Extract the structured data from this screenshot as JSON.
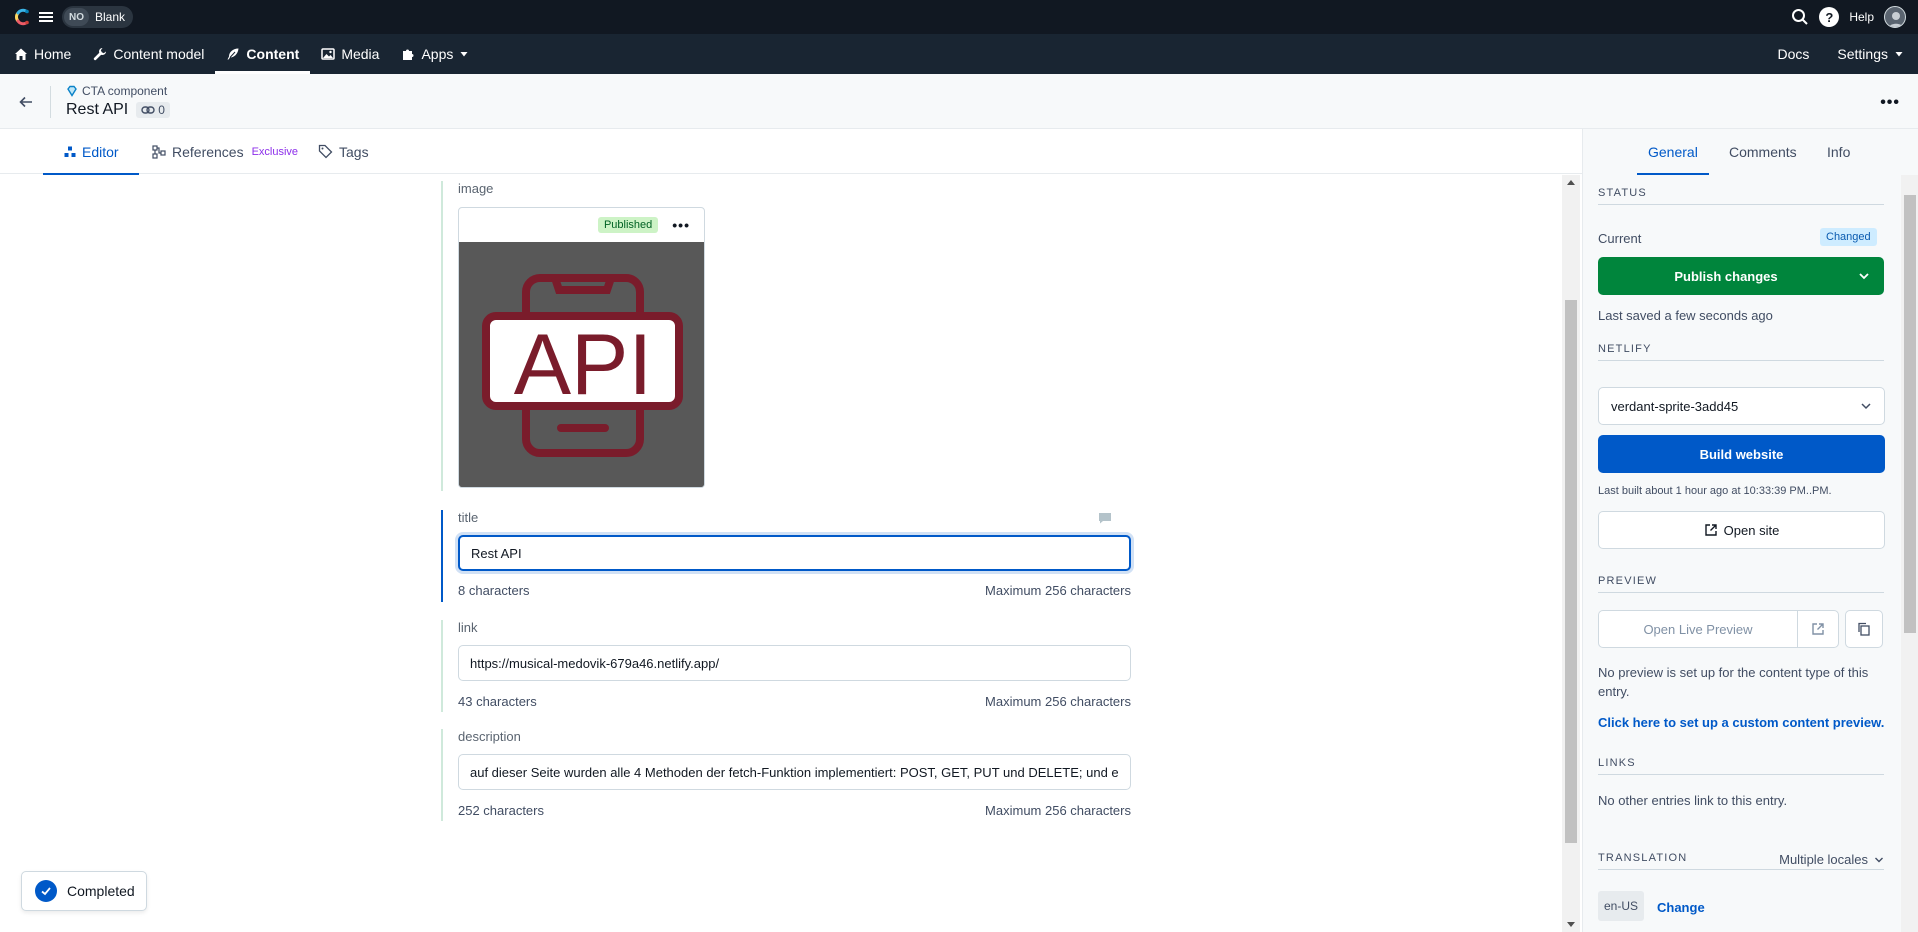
{
  "topbar": {
    "space_initials": "NO",
    "environment": "Blank",
    "help_label": "Help"
  },
  "nav": {
    "items": [
      {
        "label": "Home",
        "icon": "home-icon"
      },
      {
        "label": "Content model",
        "icon": "wrench-icon"
      },
      {
        "label": "Content",
        "icon": "feather-icon",
        "active": true
      },
      {
        "label": "Media",
        "icon": "image-icon"
      },
      {
        "label": "Apps",
        "icon": "puzzle-icon"
      }
    ],
    "docs": "Docs",
    "settings": "Settings"
  },
  "entry": {
    "content_type": "CTA component",
    "title": "Rest API",
    "references_count": "0"
  },
  "editor_tabs": {
    "editor": "Editor",
    "references": "References",
    "references_badge": "Exclusive",
    "tags": "Tags"
  },
  "fields": {
    "image": {
      "label": "image",
      "status": "Published",
      "image_text": "API"
    },
    "title": {
      "label": "title",
      "value": "Rest API",
      "count": "8 characters",
      "max": "Maximum 256 characters"
    },
    "link": {
      "label": "link",
      "value": "https://musical-medovik-679a46.netlify.app/",
      "count": "43 characters",
      "max": "Maximum 256 characters"
    },
    "description": {
      "label": "description",
      "value": "auf dieser Seite wurden alle 4 Methoden der fetch-Funktion implementiert: POST, GET, PUT und DELETE; und e",
      "count": "252 characters",
      "max": "Maximum 256 characters"
    }
  },
  "sidebar": {
    "tabs": {
      "general": "General",
      "comments": "Comments",
      "info": "Info"
    },
    "status": {
      "title": "STATUS",
      "current": "Current",
      "badge": "Changed",
      "publish": "Publish changes",
      "last_saved": "Last saved a few seconds ago"
    },
    "netlify": {
      "title": "NETLIFY",
      "site": "verdant-sprite-3add45",
      "build": "Build website",
      "last_built": "Last built about 1 hour ago at 10:33:39 PM..PM.",
      "open_site": "Open site"
    },
    "preview": {
      "title": "PREVIEW",
      "open_live": "Open Live Preview",
      "note": "No preview is set up for the content type of this entry.",
      "setup_link": "Click here to set up a custom content preview."
    },
    "links": {
      "title": "LINKS",
      "text": "No other entries link to this entry."
    },
    "translation": {
      "title": "TRANSLATION",
      "locales": "Multiple locales",
      "locale": "en-US",
      "change": "Change"
    }
  },
  "toast": {
    "label": "Completed"
  },
  "colors": {
    "topbar": "#111822",
    "navbar": "#192532",
    "primary": "#0059c8",
    "publish": "#00853c",
    "api_red": "#7a1c2b"
  }
}
